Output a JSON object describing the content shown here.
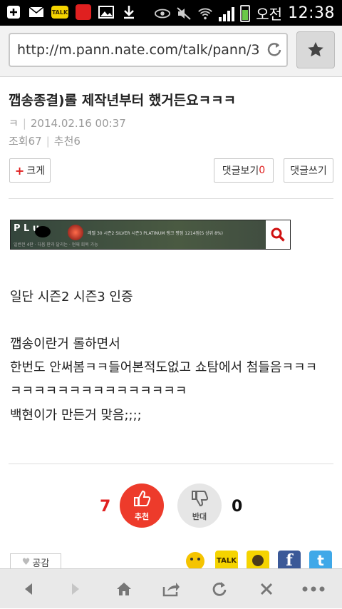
{
  "status": {
    "ampm": "오전",
    "time": "12:38",
    "talk": "TALK"
  },
  "browser": {
    "url": "http://m.pann.nate.com/talk/pann/3",
    "reload_icon": "reload-icon",
    "bookmark_icon": "star-icon"
  },
  "article": {
    "title": "깹송종결)롤 제작년부터 했거든요ㅋㅋㅋ",
    "author": "ㅋ",
    "date": "2014.02.16 00:37",
    "views_label": "조회",
    "views": "67",
    "recommend_label": "추천",
    "recommend": "6",
    "zoom_label": "크게",
    "comments_view_label": "댓글보기",
    "comments_count": "0",
    "comments_write_label": "댓글쓰기"
  },
  "banner": {
    "logo_text": "P L u",
    "info": "레벨 30   시즌2 SILVER  시즌3 PLATINUM      랭크 평점 1214점(S 상위 8%)",
    "sub": "일반전 4판 · 다음 판과 달리는 · 현재 회복 가능"
  },
  "body_lines": [
    "일단 시즌2 시즌3 인증",
    "깹송이란거 롤하면서",
    "한번도 안써봄ㅋㅋ들어본적도없고 쇼탐에서 첨들음ㅋㅋㅋ",
    "ㅋㅋㅋㅋㅋㅋㅋㅋㅋㅋㅋㅋㅋㅋㅋ",
    "백현이가 만든거 맞음;;;;"
  ],
  "vote": {
    "up_count": "7",
    "up_label": "추천",
    "down_label": "반대",
    "down_count": "0"
  },
  "share": {
    "like_label": "공감",
    "talk_label": "TALK",
    "facebook": "f",
    "twitter": "t"
  },
  "colors": {
    "accent": "#ed3b2b",
    "kakao": "#f5d400",
    "facebook": "#3b5998",
    "twitter": "#3fa8e8"
  }
}
